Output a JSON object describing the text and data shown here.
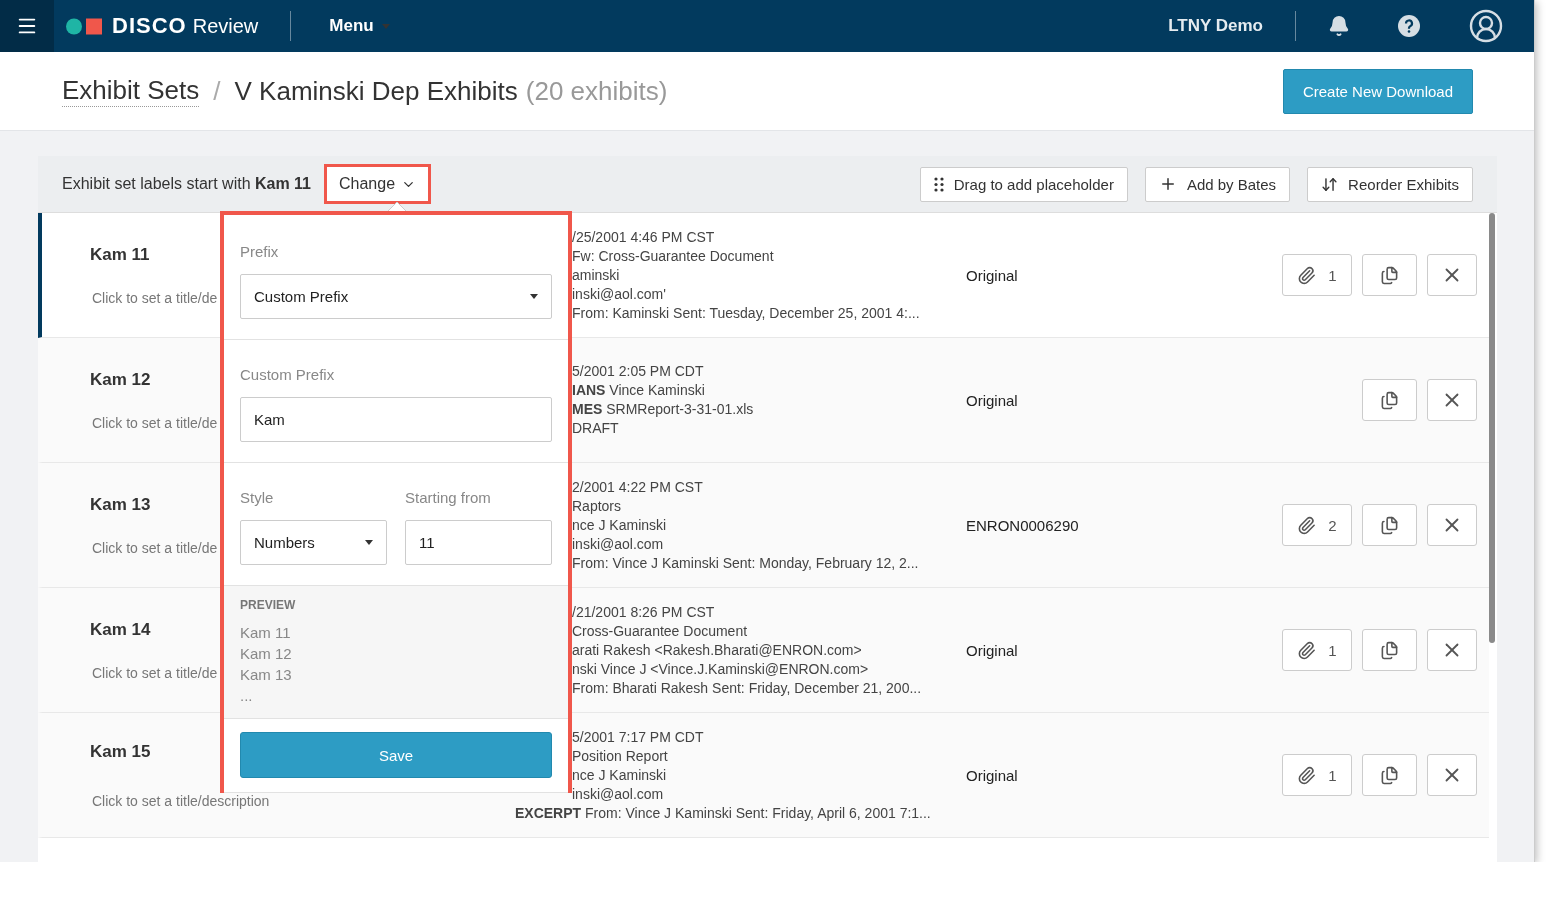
{
  "nav": {
    "brand": "DISCO",
    "product": "Review",
    "menu": "Menu",
    "account": "LTNY Demo"
  },
  "breadcrumb": {
    "parent": "Exhibit Sets",
    "separator": "/",
    "current": "V Kaminski Dep Exhibits",
    "count": "(20 exhibits)"
  },
  "primary_action": "Create New Download",
  "toolbar": {
    "label": "Exhibit set labels start with **Kam 11**",
    "change": "Change",
    "actions": [
      {
        "kind": "drag",
        "label": "Drag to add placeholder"
      },
      {
        "kind": "add",
        "label": "Add by Bates"
      },
      {
        "kind": "reorder",
        "label": "Reorder Exhibits"
      }
    ]
  },
  "exhibits": [
    {
      "label": "Kam 11",
      "description": "Click to set a title/de",
      "selected": true,
      "details": [
        "/25/2001 4:46 PM CST",
        "Fw: Cross-Guarantee Document",
        "aminski",
        "inski@aol.com'",
        "From: Kaminski Sent: Tuesday, December 25, 2001 4:..."
      ],
      "source": "Original",
      "attachments": "1"
    },
    {
      "label": "Kam 12",
      "description": "Click to set a title/de",
      "selected": false,
      "details": [
        "5/2001 2:05 PM CDT",
        "**IANS** Vince Kaminski",
        "**MES** SRMReport-3-31-01.xls",
        "DRAFT"
      ],
      "source": "Original"
    },
    {
      "label": "Kam 13",
      "description": "Click to set a title/de",
      "selected": false,
      "details": [
        "2/2001 4:22 PM CST",
        "Raptors",
        "nce J Kaminski",
        "inski@aol.com",
        "From: Vince J Kaminski Sent: Monday, February 12, 2..."
      ],
      "source": "ENRON0006290",
      "attachments": "2"
    },
    {
      "label": "Kam 14",
      "description": "Click to set a title/de",
      "selected": false,
      "details": [
        "/21/2001 8:26 PM CST",
        "Cross-Guarantee Document",
        "arati Rakesh <Rakesh.Bharati@ENRON.com>",
        "nski Vince J <Vince.J.Kaminski@ENRON.com>",
        "From: Bharati Rakesh Sent: Friday, December 21, 200..."
      ],
      "source": "Original",
      "attachments": "1"
    },
    {
      "label": "Kam 15",
      "description": "Click to set a title/description",
      "selected": false,
      "details": [
        "5/2001 7:17 PM CDT",
        "Position Report",
        "nce J Kaminski",
        "inski@aol.com",
        "**EXCERPT** From: Vince J Kaminski Sent: Friday, April 6, 2001 7:1..."
      ],
      "source": "Original",
      "attachments": "1"
    }
  ],
  "popover": {
    "prefix_label": "Prefix",
    "prefix_value": "Custom Prefix",
    "custom_label": "Custom Prefix",
    "custom_value": "Kam",
    "style_label": "Style",
    "style_value": "Numbers",
    "start_label": "Starting from",
    "start_value": "11",
    "preview_title": "PREVIEW",
    "preview": [
      "Kam 11",
      "Kam 12",
      "Kam 13",
      "..."
    ],
    "save": "Save"
  }
}
